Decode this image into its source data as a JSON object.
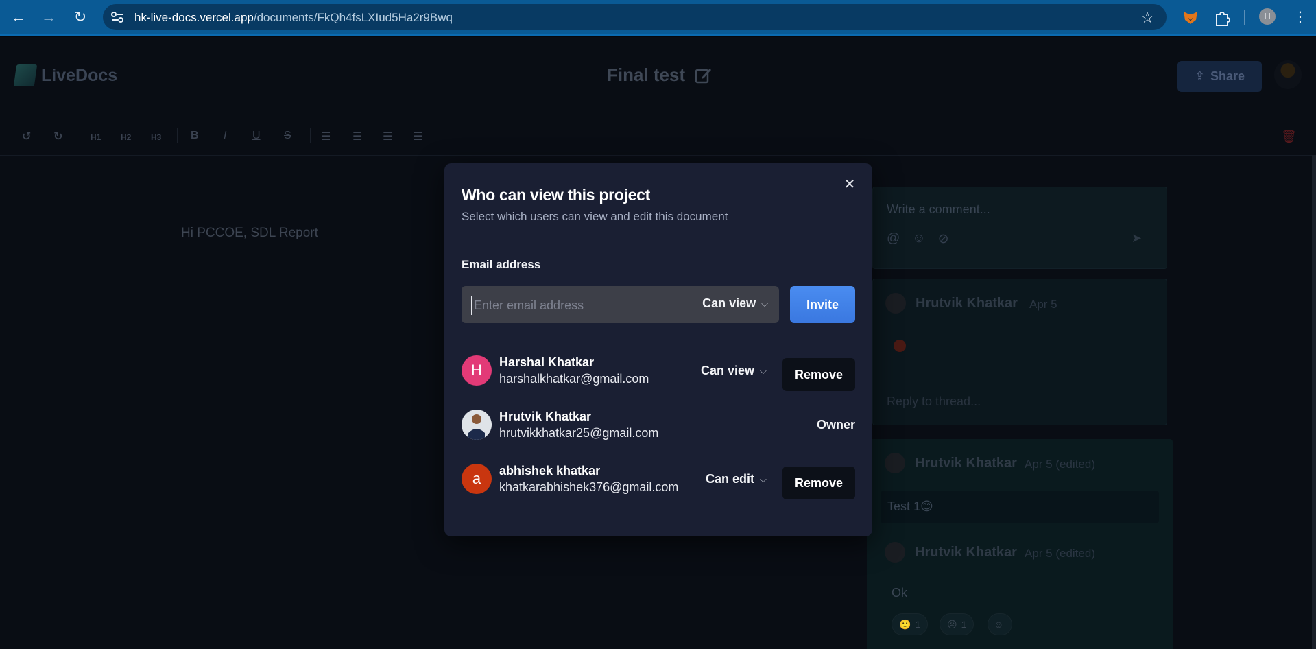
{
  "browser": {
    "url_host": "hk-live-docs.vercel.app",
    "url_path": "/documents/FkQh4fsLXIud5Ha2r9Bwq",
    "profile_initial": "H"
  },
  "app": {
    "logo_text": "LiveDocs",
    "doc_title": "Final test",
    "share_label": "Share",
    "toolbar": [
      "H1",
      "H2",
      "H3",
      "B",
      "I",
      "U",
      "S"
    ],
    "editor_text": "Hi PCCOE, SDL Report"
  },
  "comments": {
    "compose_placeholder": "Write a comment...",
    "thread1": {
      "author": "Hrutvik Khatkar",
      "date": "Apr 5",
      "reply_placeholder": "Reply to thread..."
    },
    "thread2": {
      "msg1_author": "Hrutvik Khatkar",
      "msg1_date": "Apr 5 (edited)",
      "msg1_text": "Test 1😊",
      "msg2_author": "Hrutvik Khatkar",
      "msg2_date": "Apr 5 (edited)",
      "msg2_text": "Ok",
      "reaction1_count": "1",
      "reaction2_count": "1"
    }
  },
  "modal": {
    "title": "Who can view this project",
    "subtitle": "Select which users can view and edit this document",
    "email_label": "Email address",
    "email_placeholder": "Enter email address",
    "permission_selected": "Can view",
    "invite_label": "Invite",
    "members": [
      {
        "initial": "H",
        "name": "Harshal Khatkar",
        "email": "harshalkhatkar@gmail.com",
        "permission": "Can view",
        "action": "Remove",
        "avatar_color": "#e23a77"
      },
      {
        "initial": "",
        "name": "Hrutvik Khatkar",
        "email": "hrutvikkhatkar25@gmail.com",
        "role": "Owner"
      },
      {
        "initial": "a",
        "name": "abhishek khatkar",
        "email": "khatkarabhishek376@gmail.com",
        "permission": "Can edit",
        "action": "Remove",
        "avatar_color": "#c9360f"
      }
    ]
  }
}
